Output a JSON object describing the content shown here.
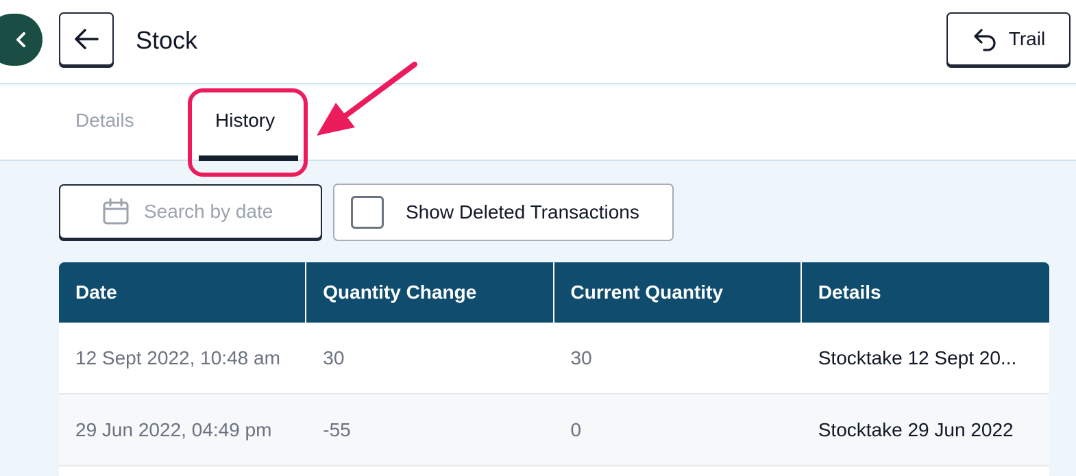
{
  "header": {
    "title": "Stock",
    "trail_label": "Trail",
    "icons": {
      "collapse": "chevron-left-icon",
      "back": "arrow-left-icon",
      "trail": "undo-arrow-icon"
    }
  },
  "tabs": [
    {
      "label": "Details",
      "active": false
    },
    {
      "label": "History",
      "active": true
    }
  ],
  "filters": {
    "date_search": {
      "placeholder": "Search by date",
      "icon": "calendar-icon"
    },
    "show_deleted": {
      "label": "Show Deleted Transactions",
      "checked": false
    }
  },
  "table": {
    "columns": [
      "Date",
      "Quantity Change",
      "Current Quantity",
      "Details"
    ],
    "rows": [
      {
        "date": "12 Sept 2022, 10:48 am",
        "quantity_change": "30",
        "current_quantity": "30",
        "details": "Stocktake 12 Sept 20..."
      },
      {
        "date": "29 Jun 2022, 04:49 pm",
        "quantity_change": "-55",
        "current_quantity": "0",
        "details": "Stocktake 29 Jun 2022"
      }
    ]
  },
  "colors": {
    "brand_dark_green": "#1a4d44",
    "table_header": "#0f4c6e",
    "annotation": "#ec1c5c",
    "page_bg": "#eef6fc"
  }
}
